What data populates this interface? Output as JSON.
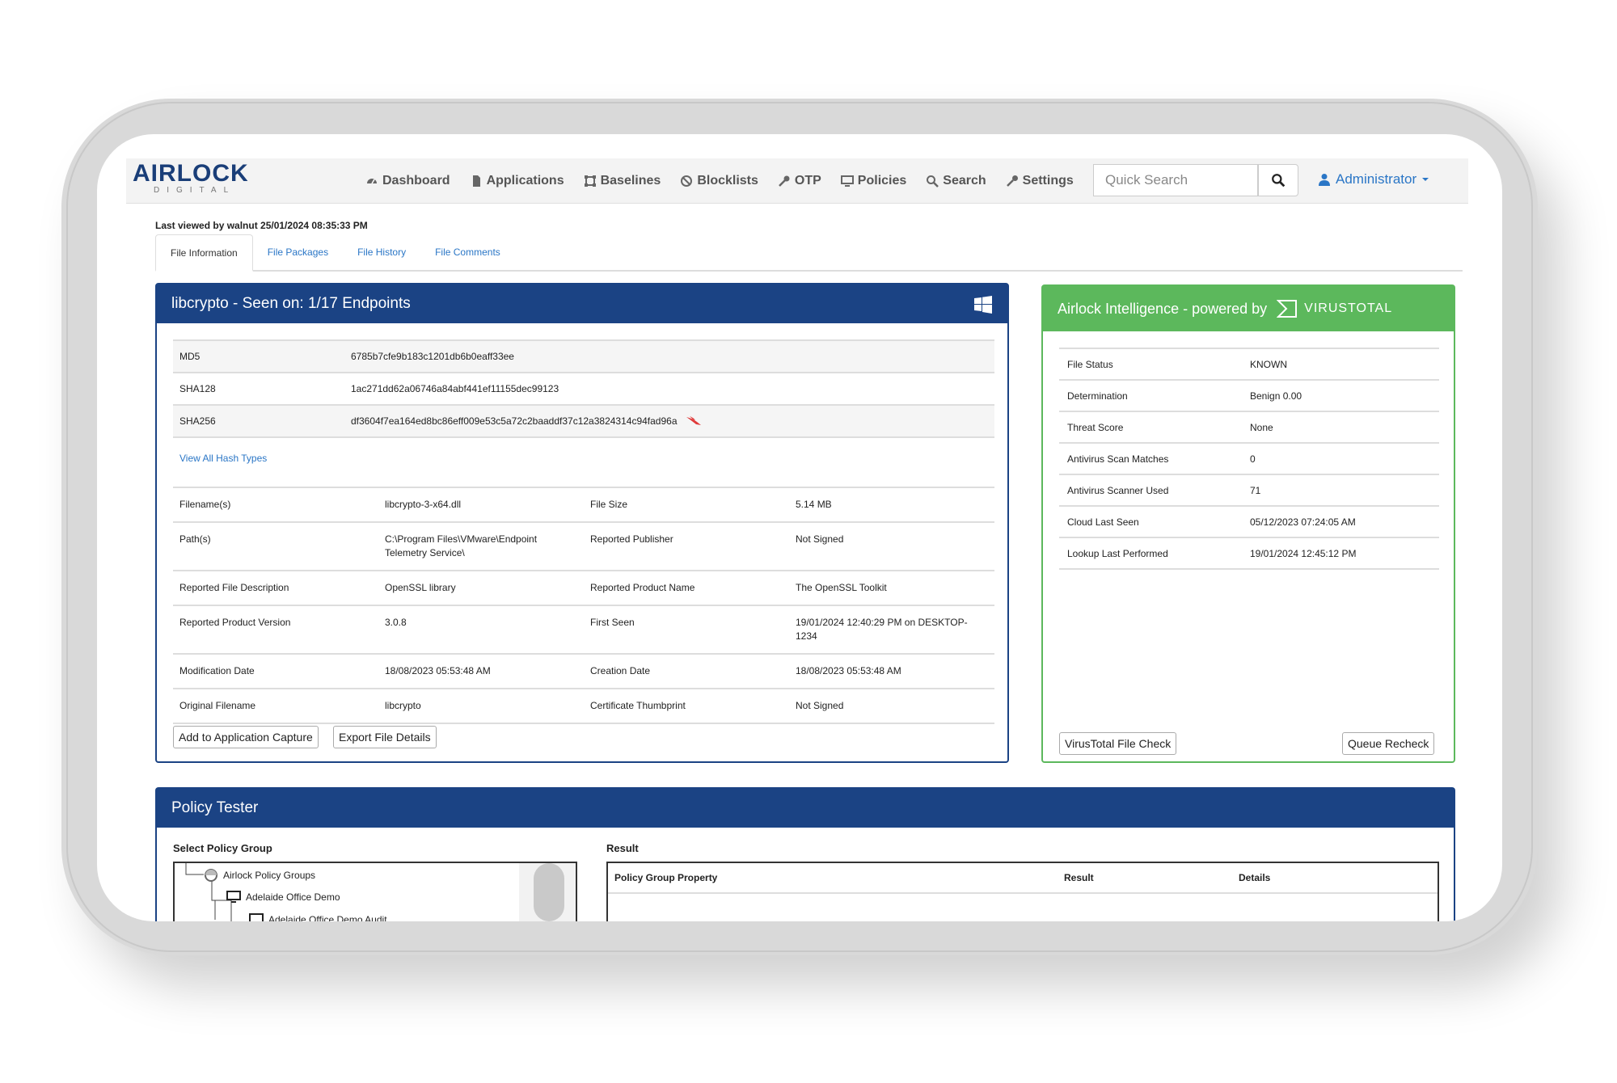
{
  "navbar": {
    "logo_text": "AIRLOCK",
    "logo_sub": "DIGITAL",
    "items": [
      {
        "label": "Dashboard",
        "icon": "dashboard-icon"
      },
      {
        "label": "Applications",
        "icon": "file-icon"
      },
      {
        "label": "Baselines",
        "icon": "baseline-icon"
      },
      {
        "label": "Blocklists",
        "icon": "ban-icon"
      },
      {
        "label": "OTP",
        "icon": "key-icon"
      },
      {
        "label": "Policies",
        "icon": "monitor-icon"
      },
      {
        "label": "Search",
        "icon": "search-icon"
      },
      {
        "label": "Settings",
        "icon": "wrench-icon"
      }
    ],
    "quick_search_placeholder": "Quick Search",
    "user_label": "Administrator"
  },
  "last_viewed": "Last viewed by walnut 25/01/2024 08:35:33 PM",
  "tabs": [
    "File Information",
    "File Packages",
    "File History",
    "File Comments"
  ],
  "file_panel": {
    "title": "libcrypto - Seen on: 1/17 Endpoints",
    "hashes": [
      {
        "key": "MD5",
        "value": "6785b7cfe9b183c1201db6b0eaff33ee"
      },
      {
        "key": "SHA128",
        "value": "1ac271dd62a06746a84abf441ef11155dec99123"
      },
      {
        "key": "SHA256",
        "value": "df3604f7ea164ed8bc86eff009e53c5a72c2baaddf37c12a3824314c94fad96a"
      }
    ],
    "view_all_label": "View All Hash Types",
    "details": [
      [
        "Filename(s)",
        "libcrypto-3-x64.dll",
        "File Size",
        "5.14 MB"
      ],
      [
        "Path(s)",
        "C:\\Program Files\\VMware\\Endpoint Telemetry Service\\",
        "Reported Publisher",
        "Not Signed"
      ],
      [
        "Reported File Description",
        "OpenSSL library",
        "Reported Product Name",
        "The OpenSSL Toolkit"
      ],
      [
        "Reported Product Version",
        "3.0.8",
        "First Seen",
        "19/01/2024 12:40:29 PM on DESKTOP-1234"
      ],
      [
        "Modification Date",
        "18/08/2023 05:53:48 AM",
        "Creation Date",
        "18/08/2023 05:53:48 AM"
      ],
      [
        "Original Filename",
        "libcrypto",
        "Certificate Thumbprint",
        "Not Signed"
      ]
    ],
    "add_capture_label": "Add to Application Capture",
    "export_label": "Export File Details"
  },
  "vt_panel": {
    "title": "Airlock Intelligence - powered by",
    "vendor": "VIRUSTOTAL",
    "rows": [
      {
        "key": "File Status",
        "value": "KNOWN"
      },
      {
        "key": "Determination",
        "value": "Benign 0.00"
      },
      {
        "key": "Threat Score",
        "value": "None"
      },
      {
        "key": "Antivirus Scan Matches",
        "value": "0"
      },
      {
        "key": "Antivirus Scanner Used",
        "value": "71"
      },
      {
        "key": "Cloud Last Seen",
        "value": "05/12/2023 07:24:05 AM"
      },
      {
        "key": "Lookup Last Performed",
        "value": "19/01/2024 12:45:12 PM"
      }
    ],
    "file_check_label": "VirusTotal File Check",
    "recheck_label": "Queue Recheck"
  },
  "policy_tester": {
    "title": "Policy Tester",
    "select_label": "Select Policy Group",
    "result_label": "Result",
    "tree": [
      "Airlock Policy Groups",
      "Adelaide Office Demo",
      "Adelaide Office Demo Audit"
    ],
    "result_columns": [
      "Policy Group Property",
      "Result",
      "Details"
    ]
  },
  "colors": {
    "primary": "#1b4384",
    "virustotal": "#5cb85c",
    "link": "#2a76c6"
  }
}
